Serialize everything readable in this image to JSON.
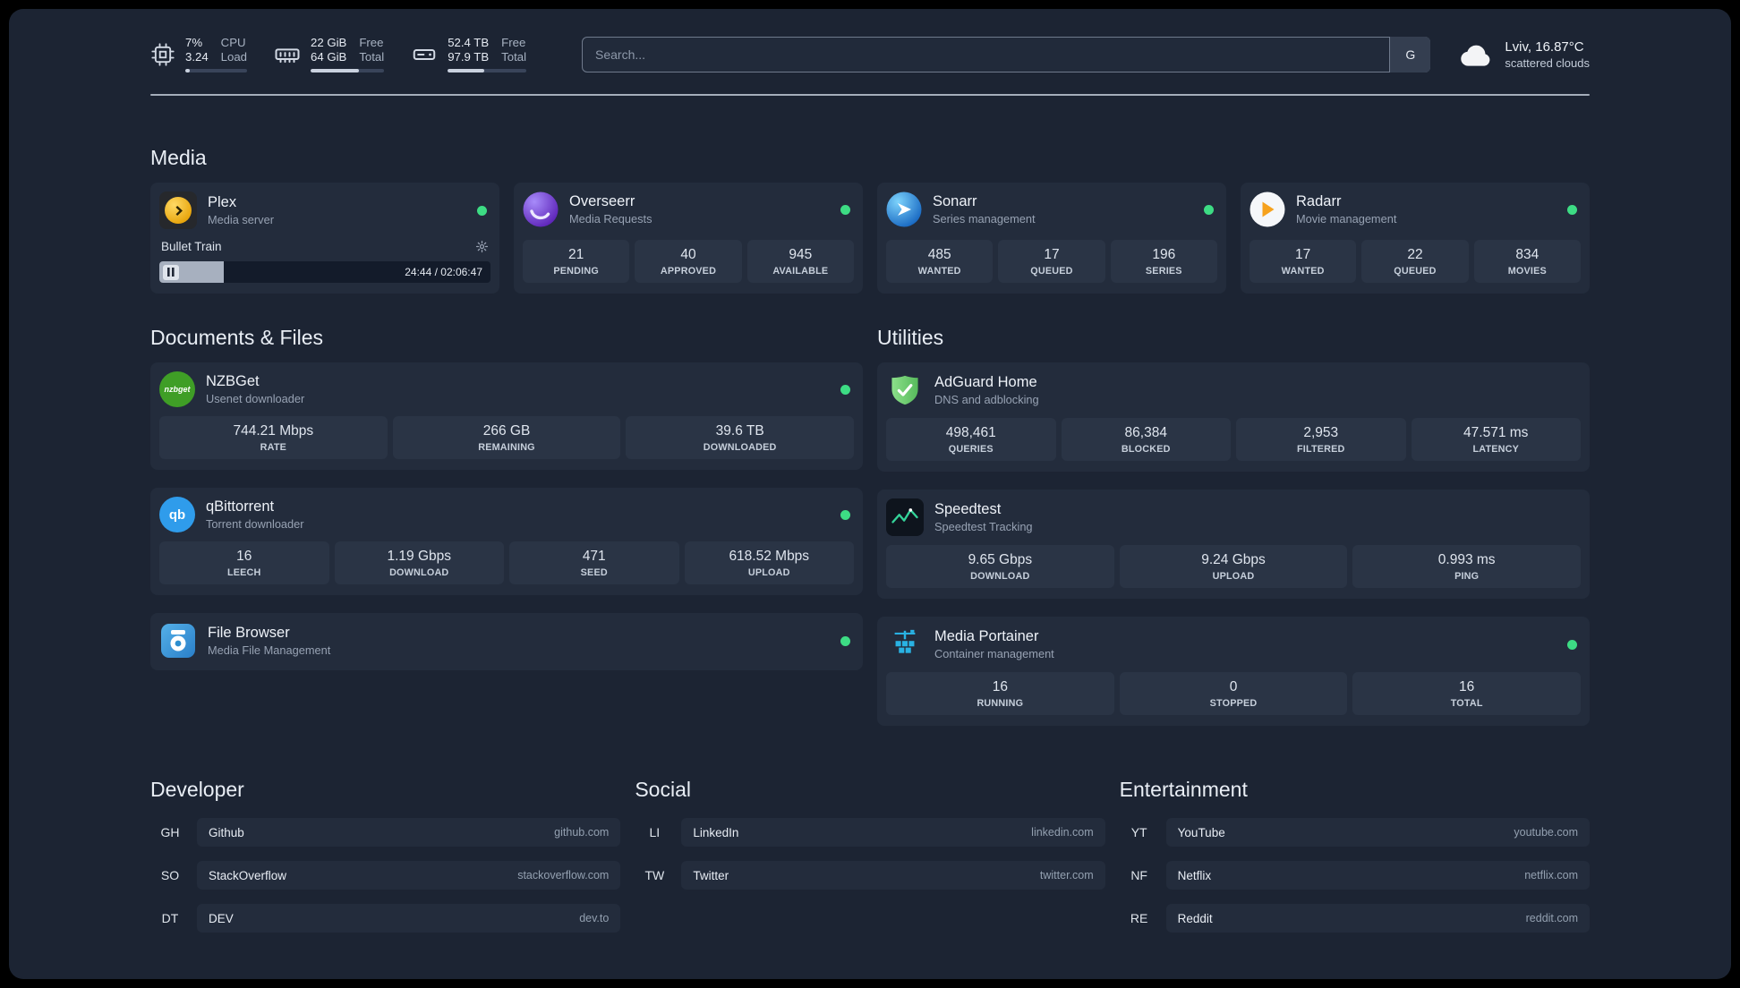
{
  "theme": {
    "status-green": "#3ddc84"
  },
  "header": {
    "resources": [
      {
        "icon": "cpu-icon",
        "value_top": "7%",
        "label_top": "CPU",
        "value_bottom": "3.24",
        "label_bottom": "Load",
        "progress_pct": 7
      },
      {
        "icon": "memory-icon",
        "value_top": "22 GiB",
        "label_top": "Free",
        "value_bottom": "64 GiB",
        "label_bottom": "Total",
        "progress_pct": 66
      },
      {
        "icon": "disk-icon",
        "value_top": "52.4 TB",
        "label_top": "Free",
        "value_bottom": "97.9 TB",
        "label_bottom": "Total",
        "progress_pct": 46
      }
    ],
    "search": {
      "placeholder": "Search...",
      "provider_button": "G"
    },
    "weather": {
      "icon": "cloud-icon",
      "location": "Lviv, 16.87°C",
      "condition": "scattered clouds"
    }
  },
  "media": {
    "heading": "Media",
    "plex": {
      "icon": "plex-icon",
      "title": "Plex",
      "subtitle": "Media server",
      "status": "online",
      "now_playing": {
        "title": "Bullet Train",
        "time": "24:44 / 02:06:47",
        "progress_pct": 19.5
      }
    },
    "overseerr": {
      "icon": "overseerr-icon",
      "title": "Overseerr",
      "subtitle": "Media Requests",
      "status": "online",
      "stats": [
        {
          "value": "21",
          "label": "PENDING"
        },
        {
          "value": "40",
          "label": "APPROVED"
        },
        {
          "value": "945",
          "label": "AVAILABLE"
        }
      ]
    },
    "sonarr": {
      "icon": "sonarr-icon",
      "title": "Sonarr",
      "subtitle": "Series management",
      "status": "online",
      "stats": [
        {
          "value": "485",
          "label": "WANTED"
        },
        {
          "value": "17",
          "label": "QUEUED"
        },
        {
          "value": "196",
          "label": "SERIES"
        }
      ]
    },
    "radarr": {
      "icon": "radarr-icon",
      "title": "Radarr",
      "subtitle": "Movie management",
      "status": "online",
      "stats": [
        {
          "value": "17",
          "label": "WANTED"
        },
        {
          "value": "22",
          "label": "QUEUED"
        },
        {
          "value": "834",
          "label": "MOVIES"
        }
      ]
    }
  },
  "documents": {
    "heading": "Documents & Files",
    "nzbget": {
      "icon": "nzbget-icon",
      "icon_text": "nzbget",
      "title": "NZBGet",
      "subtitle": "Usenet downloader",
      "status": "online",
      "stats": [
        {
          "value": "744.21 Mbps",
          "label": "RATE"
        },
        {
          "value": "266 GB",
          "label": "REMAINING"
        },
        {
          "value": "39.6 TB",
          "label": "DOWNLOADED"
        }
      ]
    },
    "qbittorrent": {
      "icon": "qbittorrent-icon",
      "icon_text": "qb",
      "title": "qBittorrent",
      "subtitle": "Torrent downloader",
      "status": "online",
      "stats": [
        {
          "value": "16",
          "label": "LEECH"
        },
        {
          "value": "1.19 Gbps",
          "label": "DOWNLOAD"
        },
        {
          "value": "471",
          "label": "SEED"
        },
        {
          "value": "618.52 Mbps",
          "label": "UPLOAD"
        }
      ]
    },
    "filebrowser": {
      "icon": "filebrowser-icon",
      "title": "File Browser",
      "subtitle": "Media File Management",
      "status": "online"
    }
  },
  "utilities": {
    "heading": "Utilities",
    "adguard": {
      "icon": "adguard-icon",
      "title": "AdGuard Home",
      "subtitle": "DNS and adblocking",
      "stats": [
        {
          "value": "498,461",
          "label": "QUERIES"
        },
        {
          "value": "86,384",
          "label": "BLOCKED"
        },
        {
          "value": "2,953",
          "label": "FILTERED"
        },
        {
          "value": "47.571 ms",
          "label": "LATENCY"
        }
      ]
    },
    "speedtest": {
      "icon": "speedtest-icon",
      "title": "Speedtest",
      "subtitle": "Speedtest Tracking",
      "stats": [
        {
          "value": "9.65 Gbps",
          "label": "DOWNLOAD"
        },
        {
          "value": "9.24 Gbps",
          "label": "UPLOAD"
        },
        {
          "value": "0.993 ms",
          "label": "PING"
        }
      ]
    },
    "portainer": {
      "icon": "portainer-icon",
      "title": "Media Portainer",
      "subtitle": "Container management",
      "status": "online",
      "stats": [
        {
          "value": "16",
          "label": "RUNNING"
        },
        {
          "value": "0",
          "label": "STOPPED"
        },
        {
          "value": "16",
          "label": "TOTAL"
        }
      ]
    }
  },
  "bookmarks": {
    "developer": {
      "heading": "Developer",
      "items": [
        {
          "abbr": "GH",
          "name": "Github",
          "url": "github.com"
        },
        {
          "abbr": "SO",
          "name": "StackOverflow",
          "url": "stackoverflow.com"
        },
        {
          "abbr": "DT",
          "name": "DEV",
          "url": "dev.to"
        }
      ]
    },
    "social": {
      "heading": "Social",
      "items": [
        {
          "abbr": "LI",
          "name": "LinkedIn",
          "url": "linkedin.com"
        },
        {
          "abbr": "TW",
          "name": "Twitter",
          "url": "twitter.com"
        }
      ]
    },
    "entertainment": {
      "heading": "Entertainment",
      "items": [
        {
          "abbr": "YT",
          "name": "YouTube",
          "url": "youtube.com"
        },
        {
          "abbr": "NF",
          "name": "Netflix",
          "url": "netflix.com"
        },
        {
          "abbr": "RE",
          "name": "Reddit",
          "url": "reddit.com"
        }
      ]
    }
  }
}
